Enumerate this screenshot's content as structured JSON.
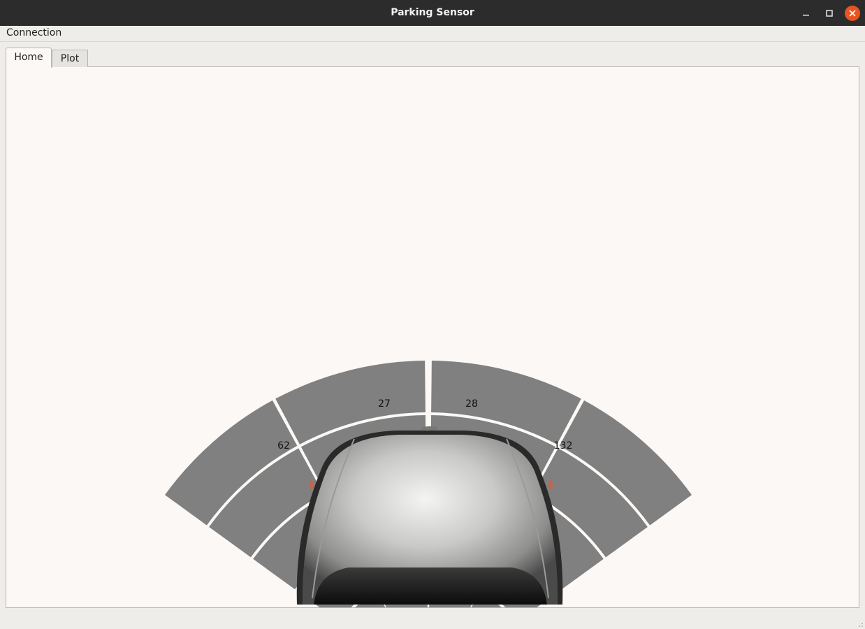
{
  "window": {
    "title": "Parking Sensor"
  },
  "menu": {
    "items": [
      {
        "label": "Connection"
      }
    ]
  },
  "tabs": [
    {
      "label": "Home",
      "active": true
    },
    {
      "label": "Plot",
      "active": false
    }
  ],
  "colors": {
    "segment_inactive": "#808080",
    "segment_active": "#f40000",
    "panel_background": "#fbf8f5"
  },
  "sensors": [
    {
      "id": "left-outer",
      "reading": "62",
      "active_band": null
    },
    {
      "id": "left-inner",
      "reading": "27",
      "active_band": 3
    },
    {
      "id": "right-inner",
      "reading": "28",
      "active_band": 3
    },
    {
      "id": "right-outer",
      "reading": "132",
      "active_band": null
    }
  ],
  "radar": {
    "bands": 5,
    "sensors": 4
  },
  "car": {
    "icon": "car-top-view-icon"
  }
}
